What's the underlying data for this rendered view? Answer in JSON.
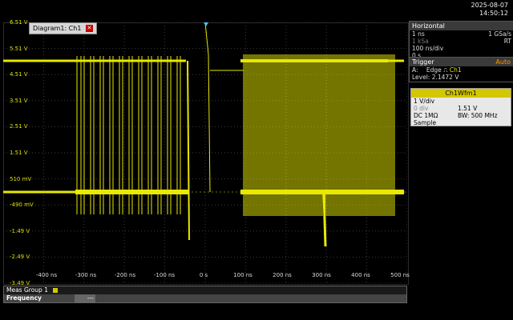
{
  "datetime": {
    "date": "2025-08-07",
    "time": "14:50:12"
  },
  "diagram_tab": {
    "label": "Diagram1: Ch1"
  },
  "y_labels": [
    "6.51 V",
    "5.51 V",
    "4.51 V",
    "3.51 V",
    "2.51 V",
    "1.51 V",
    "510 mV",
    "-490 mV",
    "-1.49 V",
    "-2.49 V",
    "-3.49 V"
  ],
  "x_labels": [
    "-400 ns",
    "-300 ns",
    "-200 ns",
    "-100 ns",
    "0 s",
    "100 ns",
    "200 ns",
    "300 ns",
    "400 ns",
    "500 ns"
  ],
  "horizontal": {
    "title": "Horizontal",
    "row1_left": "1 ns",
    "row1_right": "1 GSa/s",
    "row2_left": "1 kSa",
    "row2_right": "RT",
    "row3": "100 ns/div",
    "row4": "0 s"
  },
  "trigger": {
    "title": "Trigger",
    "mode": "Auto",
    "source_prefix": "A:",
    "type": "Edge",
    "channel": "Ch1",
    "level": "Level: 2.1472 V"
  },
  "waveform": {
    "title": "Ch1Wfm1",
    "scale": "1 V/div",
    "offset_label": "0 div",
    "offset_value": "1.51 V",
    "coupling": "DC 1MΩ",
    "bandwidth": "BW: 500 MHz",
    "acq": "Sample"
  },
  "meas": {
    "group": "Meas Group 1",
    "param": "Frequency",
    "value": "---"
  },
  "colors": {
    "trace": "#e8e800",
    "panel_header": "#3a3a3a",
    "wfm_header": "#d4c600"
  }
}
